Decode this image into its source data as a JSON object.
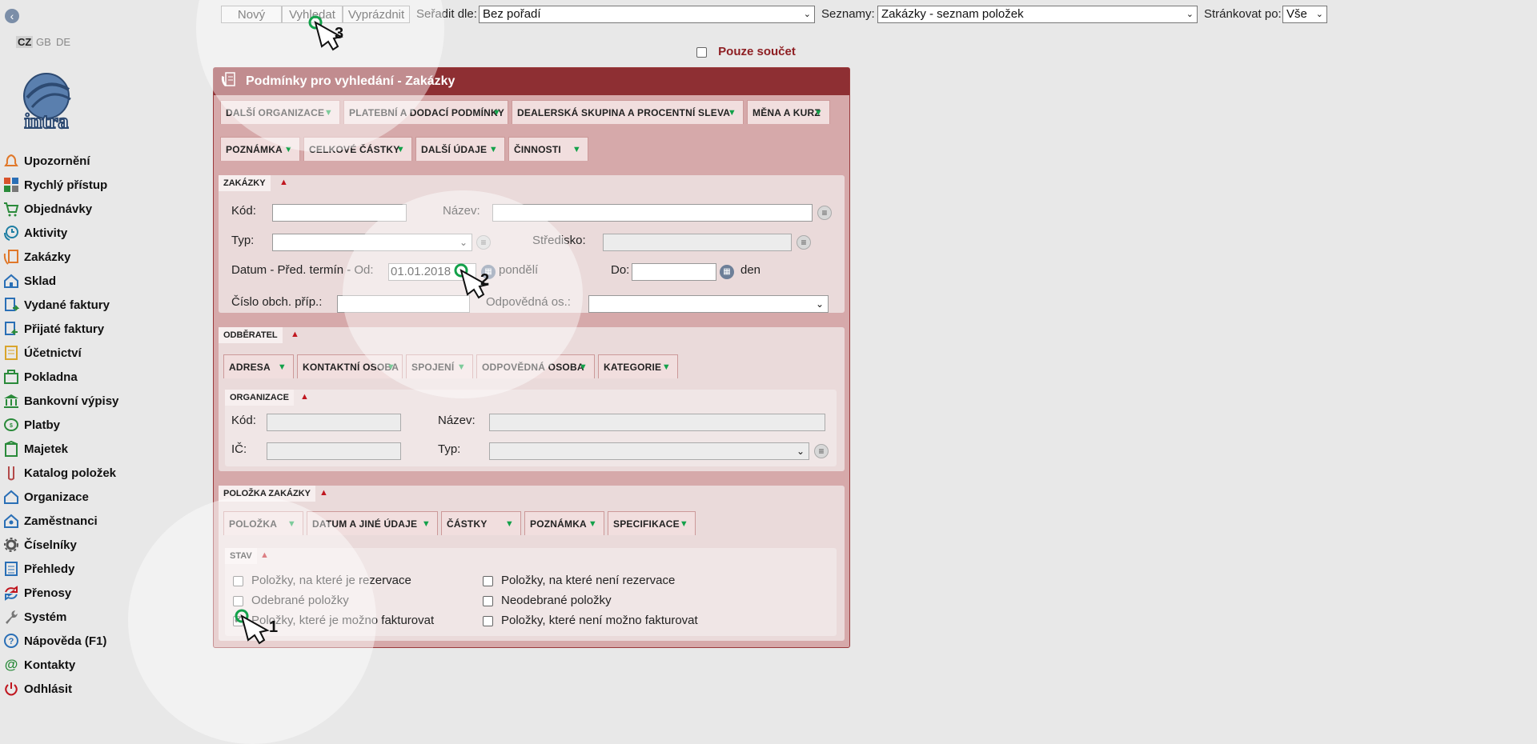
{
  "languages": [
    "CZ",
    "GB",
    "DE"
  ],
  "logo_text": "intra",
  "nav": [
    {
      "label": "Upozornění",
      "icon": "bell-icon",
      "color": "#e0782a"
    },
    {
      "label": "Rychlý přístup",
      "icon": "tiles-icon",
      "color": "#d9532c"
    },
    {
      "label": "Objednávky",
      "icon": "cart-icon",
      "color": "#2a8a3a"
    },
    {
      "label": "Aktivity",
      "icon": "clock-phone-icon",
      "color": "#1e7ea3"
    },
    {
      "label": "Zakázky",
      "icon": "phone-list-icon",
      "color": "#e0782a"
    },
    {
      "label": "Sklad",
      "icon": "house-icon",
      "color": "#2a6fb6"
    },
    {
      "label": "Vydané faktury",
      "icon": "invoice-out-icon",
      "color": "#2a6fb6"
    },
    {
      "label": "Přijaté faktury",
      "icon": "invoice-in-icon",
      "color": "#2a6fb6"
    },
    {
      "label": "Účetnictví",
      "icon": "ledger-icon",
      "color": "#d9a52c"
    },
    {
      "label": "Pokladna",
      "icon": "cashbox-icon",
      "color": "#2a8a3a"
    },
    {
      "label": "Bankovní výpisy",
      "icon": "bank-icon",
      "color": "#2a8a3a"
    },
    {
      "label": "Platby",
      "icon": "coin-icon",
      "color": "#2a8a3a"
    },
    {
      "label": "Majetek",
      "icon": "building-icon",
      "color": "#2a8a3a"
    },
    {
      "label": "Katalog položek",
      "icon": "tag-icon",
      "color": "#b34a4a"
    },
    {
      "label": "Organizace",
      "icon": "org-house-icon",
      "color": "#2a6fb6"
    },
    {
      "label": "Zaměstnanci",
      "icon": "employee-house-icon",
      "color": "#2a6fb6"
    },
    {
      "label": "Číselníky",
      "icon": "gear-icon",
      "color": "#555555"
    },
    {
      "label": "Přehledy",
      "icon": "list-icon",
      "color": "#2a6fb6"
    },
    {
      "label": "Přenosy",
      "icon": "sync-icon",
      "color": "#c0161f"
    },
    {
      "label": "Systém",
      "icon": "wrench-icon",
      "color": "#777777"
    },
    {
      "label": "Nápověda (F1)",
      "icon": "help-icon",
      "color": "#2a6fb6"
    },
    {
      "label": "Kontakty",
      "icon": "at-icon",
      "color": "#2a8a3a"
    },
    {
      "label": "Odhlásit",
      "icon": "power-icon",
      "color": "#c0161f"
    }
  ],
  "toolbar": {
    "new_label": "Nový",
    "search_label": "Vyhledat",
    "clear_label": "Vyprázdnit",
    "sort_label": "Seřadit dle:",
    "sort_value": "Bez pořadí",
    "lists_label": "Seznamy:",
    "lists_value": "Zakázky - seznam položek",
    "paging_label": "Stránkovat po:",
    "paging_value": "Vše",
    "sum_only_label": "Pouze součet",
    "sum_only_checked": false
  },
  "panel": {
    "title": "Podmínky pro vyhledání - Zakázky",
    "tabs_row1": [
      "DALŠÍ ORGANIZACE",
      "PLATEBNÍ A DODACÍ PODMÍNKY",
      "DEALERSKÁ SKUPINA A PROCENTNÍ SLEVA",
      "MĚNA A KURZ"
    ],
    "tabs_row2": [
      "POZNÁMKA",
      "CELKOVÉ ČÁSTKY",
      "DALŠÍ ÚDAJE",
      "ČINNOSTI"
    ],
    "zakazky": {
      "title": "ZAKÁZKY",
      "kod_label": "Kód:",
      "nazev_label": "Název:",
      "typ_label": "Typ:",
      "stredisko_label": "Středisko:",
      "datum_label": "Datum - Před. termín - Od:",
      "datum_from": "01.01.2018",
      "datum_from_day": "pondělí",
      "do_label": "Do:",
      "do_day": "den",
      "cislo_label": "Číslo obch. příp.:",
      "odpovedna_label": "Odpovědná os.:"
    },
    "odberatel": {
      "title": "ODBĚRATEL",
      "tabs": [
        "ADRESA",
        "KONTAKTNÍ OSOBA",
        "SPOJENÍ",
        "ODPOVĚDNÁ OSOBA",
        "KATEGORIE"
      ],
      "organizace": {
        "title": "ORGANIZACE",
        "kod_label": "Kód:",
        "nazev_label": "Název:",
        "ic_label": "IČ:",
        "typ_label": "Typ:"
      }
    },
    "polozka": {
      "title": "POLOŽKA ZAKÁZKY",
      "tabs": [
        "POLOŽKA",
        "DATUM A JINÉ ÚDAJE",
        "ČÁSTKY",
        "POZNÁMKA",
        "SPECIFIKACE"
      ],
      "stav": {
        "title": "STAV",
        "options_left": [
          {
            "label": "Položky, na které je rezervace",
            "checked": false
          },
          {
            "label": "Odebrané položky",
            "checked": false
          },
          {
            "label": "Položky, které je možno fakturovat",
            "checked": true
          }
        ],
        "options_right": [
          {
            "label": "Položky, na které není rezervace",
            "checked": false
          },
          {
            "label": "Neodebrané položky",
            "checked": false
          },
          {
            "label": "Položky, které není možno fakturovat",
            "checked": false
          }
        ]
      }
    }
  },
  "callouts": [
    "1",
    "2",
    "3"
  ],
  "accent": "#8e2f33",
  "tab_arrow_color": "#13a14a"
}
